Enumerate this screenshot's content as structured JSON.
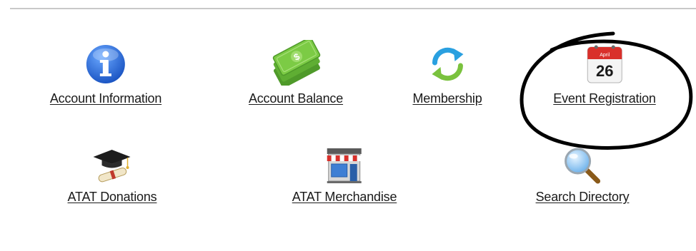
{
  "menu": {
    "items": [
      {
        "label": "Account Information",
        "icon": "info-icon"
      },
      {
        "label": "Account Balance",
        "icon": "money-icon"
      },
      {
        "label": "Membership",
        "icon": "refresh-icon"
      },
      {
        "label": "Event Registration",
        "icon": "calendar-icon",
        "calendar_month": "April",
        "calendar_day": "26"
      },
      {
        "label": "ATAT Donations",
        "icon": "graduation-cap-icon"
      },
      {
        "label": "ATAT Merchandise",
        "icon": "store-icon"
      },
      {
        "label": "Search Directory",
        "icon": "magnifier-icon"
      }
    ]
  },
  "colors": {
    "info_blue": "#2f6fd6",
    "money_green": "#6dbd3c",
    "refresh_blue": "#2aa0e0",
    "refresh_green": "#7ac23e",
    "calendar_red": "#d9302b",
    "annotation": "#000000"
  }
}
